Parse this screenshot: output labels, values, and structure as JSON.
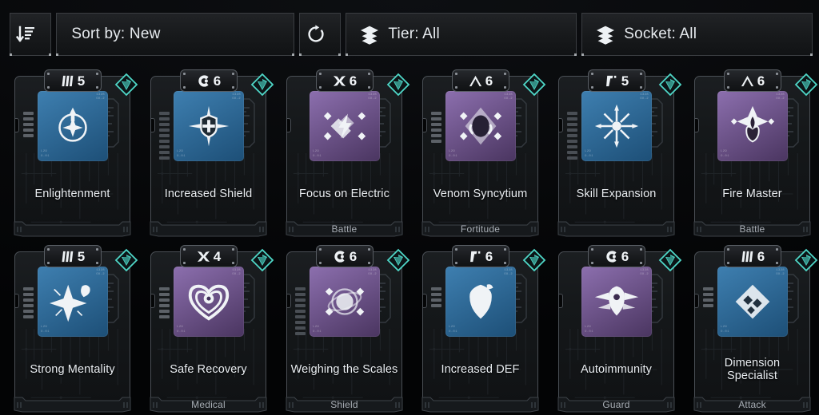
{
  "toolbar": {
    "sort_icon": "sort-descending-icon",
    "sort_label": "Sort by: New",
    "refresh_icon": "refresh-icon",
    "tier_icon": "layers-icon",
    "tier_label": "Tier: All",
    "socket_icon": "layers-icon",
    "socket_label": "Socket: All"
  },
  "colors": {
    "accent_socket": "#4fd8c8",
    "art_blue_start": "#3e7fb0",
    "art_blue_end": "#1d4f77",
    "art_purple_start": "#8c6fae",
    "art_purple_end": "#4a3560",
    "card_border": "#4a4f55",
    "text_primary": "#e9edf1",
    "text_muted": "#a8aeb5"
  },
  "art_corner_text": {
    "top_right": "1328\nOX-2",
    "bottom_left": "L29\nO.01"
  },
  "cards": [
    {
      "name": "Enlightenment",
      "tier_symbol": "tri-bars",
      "level": "5",
      "category": "",
      "art_color": "blue",
      "icon": "compass-star-icon",
      "ticks": 5,
      "socket": true
    },
    {
      "name": "Increased Shield",
      "tier_symbol": "c-dot",
      "level": "6",
      "category": "",
      "art_color": "blue",
      "icon": "shield-compass-icon",
      "ticks": 9,
      "socket": true
    },
    {
      "name": "Focus on Electric",
      "tier_symbol": "x-star",
      "level": "6",
      "category": "Battle",
      "art_color": "purple",
      "icon": "lightning-diamond-icon",
      "ticks": 0,
      "socket": true
    },
    {
      "name": "Venom Syncytium",
      "tier_symbol": "caret",
      "level": "6",
      "category": "Fortitude",
      "art_color": "purple",
      "icon": "venom-core-icon",
      "ticks": 6,
      "socket": true
    },
    {
      "name": "Skill Expansion",
      "tier_symbol": "gamma",
      "level": "5",
      "category": "",
      "art_color": "blue",
      "icon": "radial-burst-icon",
      "ticks": 9,
      "socket": true
    },
    {
      "name": "Fire Master",
      "tier_symbol": "caret",
      "level": "6",
      "category": "Battle",
      "art_color": "purple",
      "icon": "flame-lattice-icon",
      "ticks": 0,
      "socket": true
    },
    {
      "name": "Strong Mentality",
      "tier_symbol": "tri-bars",
      "level": "5",
      "category": "",
      "art_color": "blue",
      "icon": "sparkle-burst-icon",
      "ticks": 6,
      "socket": true
    },
    {
      "name": "Safe Recovery",
      "tier_symbol": "x-star",
      "level": "4",
      "category": "Medical",
      "art_color": "purple",
      "icon": "heart-target-icon",
      "ticks": 6,
      "socket": true
    },
    {
      "name": "Weighing the Scales",
      "tier_symbol": "c-dot",
      "level": "6",
      "category": "Shield",
      "art_color": "purple",
      "icon": "orb-ring-icon",
      "ticks": 9,
      "socket": true
    },
    {
      "name": "Increased DEF",
      "tier_symbol": "gamma",
      "level": "6",
      "category": "",
      "art_color": "blue",
      "icon": "shield-plate-icon",
      "ticks": 4,
      "socket": true
    },
    {
      "name": "Autoimmunity",
      "tier_symbol": "c-dot",
      "level": "6",
      "category": "Guard",
      "art_color": "purple",
      "icon": "winged-crest-icon",
      "ticks": 0,
      "socket": true
    },
    {
      "name": "Dimension Specialist",
      "tier_symbol": "tri-bars",
      "level": "6",
      "category": "Attack",
      "art_color": "blue",
      "icon": "dimension-cube-icon",
      "ticks": 4,
      "socket": true
    }
  ]
}
